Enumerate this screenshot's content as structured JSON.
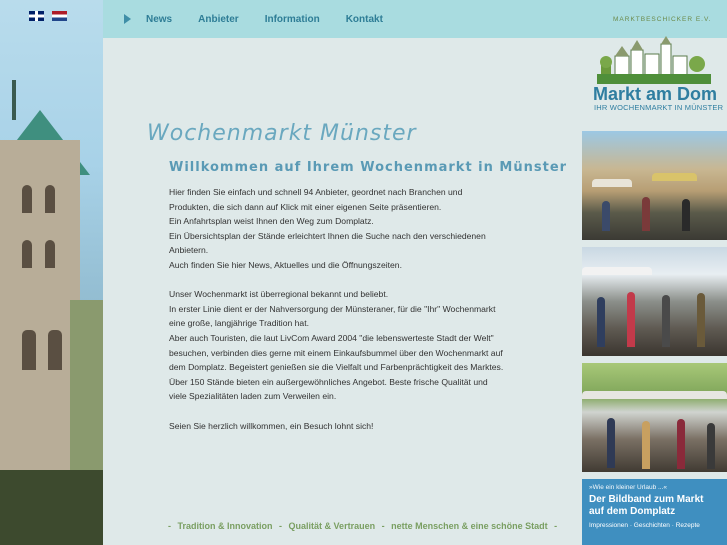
{
  "nav": {
    "flags": [
      "English",
      "Nederlands"
    ],
    "items": [
      "News",
      "Anbieter",
      "Information",
      "Kontakt"
    ]
  },
  "logo": {
    "arc": "MARKTBESCHICKER E.V.",
    "title": "Markt am Dom",
    "subtitle": "IHR WOCHENMARKT IN MÜNSTER"
  },
  "main": {
    "title": "Wochenmarkt Münster",
    "subtitle": "Willkommen auf Ihrem Wochenmarkt in Münster",
    "paragraph1": [
      "Hier finden Sie einfach und schnell 94 Anbieter, geordnet nach Branchen und",
      "Produkten, die sich dann auf Klick mit einer eigenen Seite präsentieren.",
      "Ein Anfahrtsplan weist Ihnen den Weg zum Domplatz.",
      "Ein Übersichtsplan der Stände erleichtert Ihnen die Suche nach den verschiedenen",
      "Anbietern.",
      "Auch finden Sie hier News, Aktuelles und die Öffnungszeiten."
    ],
    "paragraph2": [
      "Unser Wochenmarkt ist überregional bekannt und beliebt.",
      "In erster Linie dient er der Nahversorgung der Münsteraner, für die \"Ihr\" Wochenmarkt",
      "eine große, langjährige Tradition hat.",
      "Aber auch Touristen, die laut LivCom Award 2004 \"die lebenswerteste Stadt der Welt\"",
      "besuchen, verbinden dies gerne mit einem Einkaufsbummel über den Wochenmarkt auf",
      "dem Domplatz. Begeistert genießen sie die Vielfalt und Farbenprächtigkeit des Marktes.",
      "Über 150 Stände bieten ein außergewöhnliches Angebot. Beste frische Qualität und",
      "viele Spezialitäten laden zum Verweilen ein."
    ],
    "closing": "Seien Sie herzlich willkommen, ein Besuch lohnt sich!"
  },
  "footer": {
    "items": [
      "Tradition & Innovation",
      "Qualität & Vertrauen",
      "nette Menschen & eine schöne Stadt"
    ]
  },
  "promo": {
    "small": "»Wie ein kleiner Urlaub ...«",
    "big_line1": "Der Bildband zum Markt",
    "big_line2": "auf dem Domplatz",
    "foot": "Impressionen · Geschichten · Rezepte"
  },
  "colors": {
    "nav_bar": "#a9dce0",
    "nav_text": "#2e7d96",
    "title": "#6aa8bf",
    "footer_green": "#7a9f62",
    "promo_blue": "#3f8fc0"
  }
}
